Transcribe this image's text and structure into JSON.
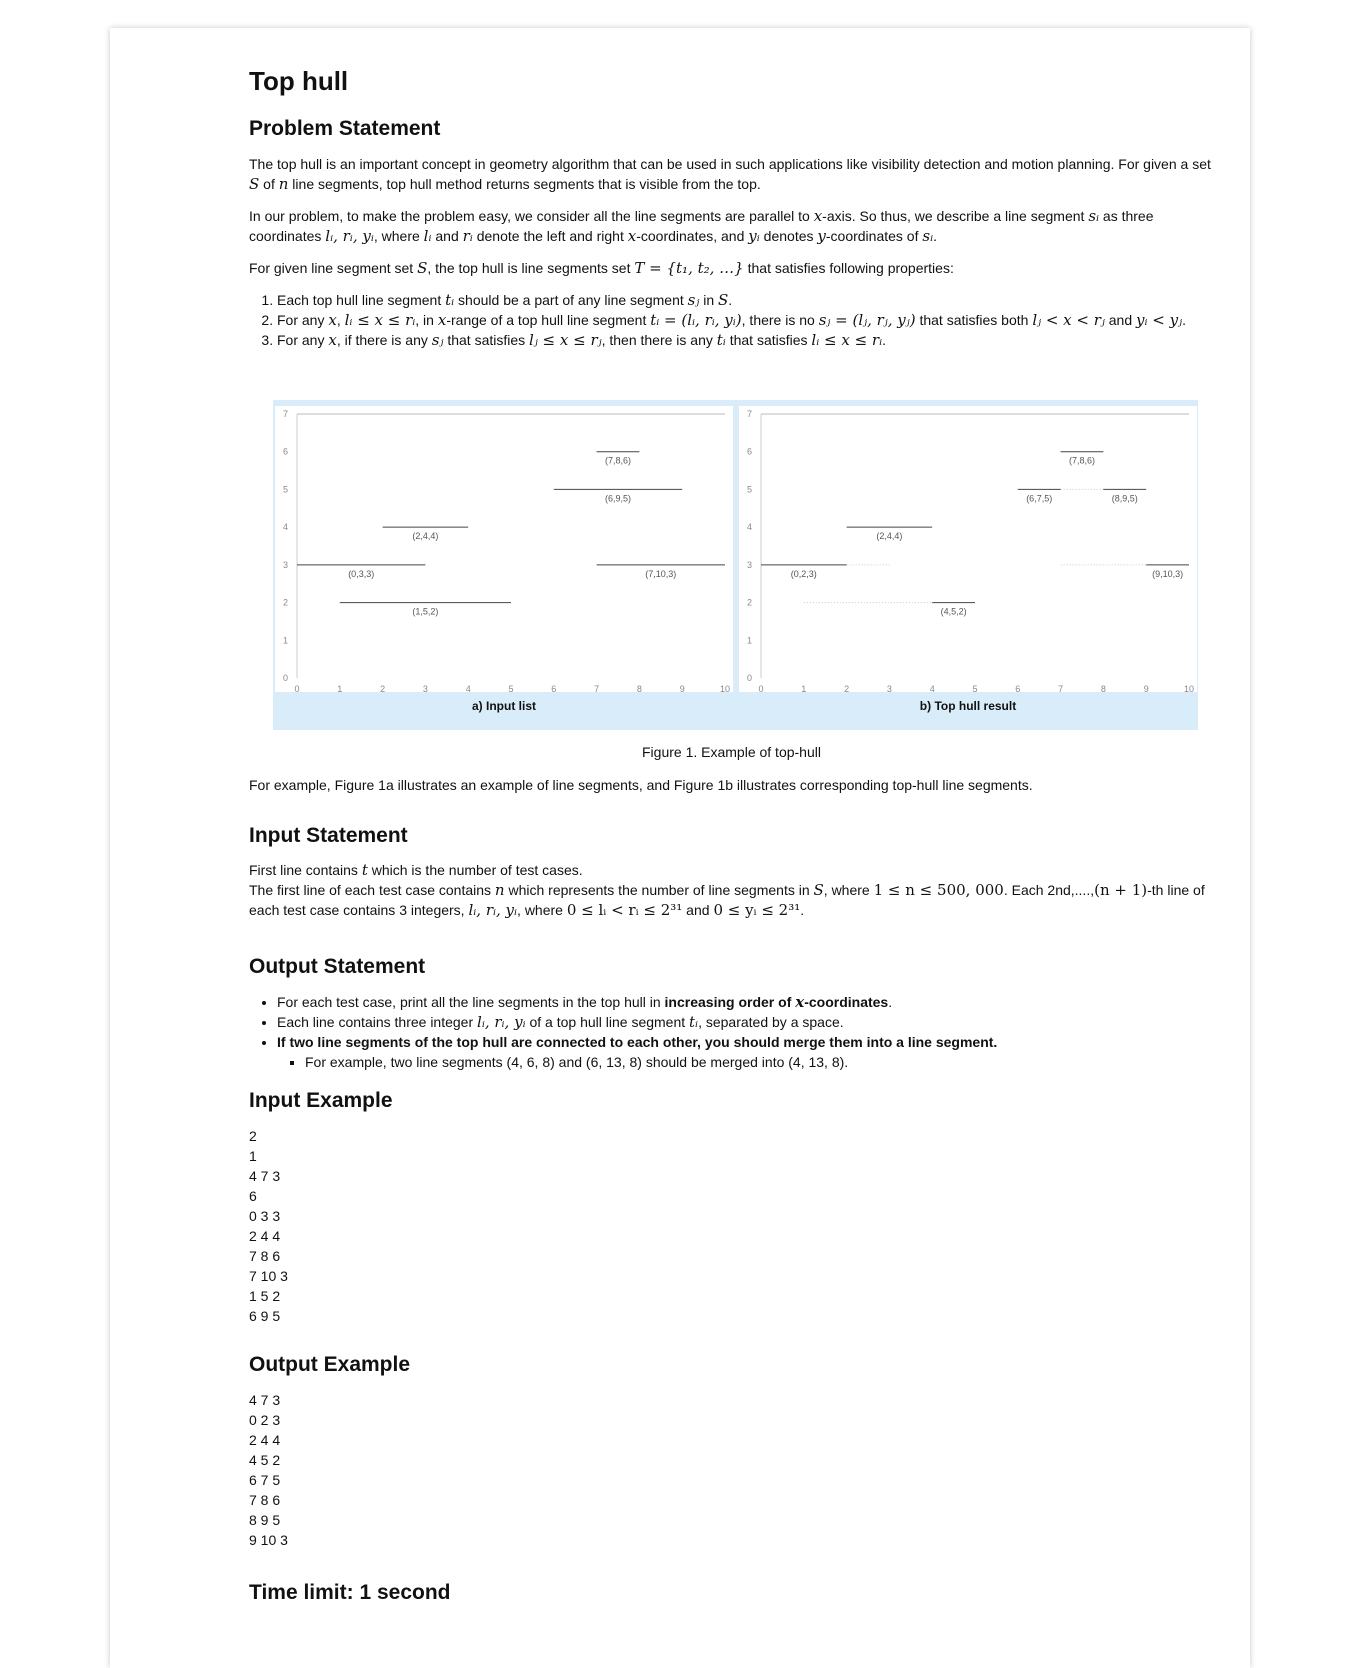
{
  "title": "Top hull",
  "problem": {
    "heading": "Problem Statement",
    "p1_a": "The top hull is an important concept in geometry algorithm that can be used in such applications like visibility detection and motion planning. For given a set ",
    "p1_b": " line segments, top hull method returns segments that is visible from the top.",
    "p2_a": "In our problem, to make the problem easy, we consider all the line segments are parallel to ",
    "p2_b": "-axis. So thus, we describe a line segment ",
    "p2_c": " as three coordinates ",
    "p2_d": ", where ",
    "p2_e": " and ",
    "p2_f": " denote the left and right ",
    "p2_g": "-coordinates, and ",
    "p2_h": " denotes ",
    "p2_i": "-coordinates of ",
    "p3_a": "For given line segment set ",
    "p3_b": ", the top hull is line segments set ",
    "p3_c": " that satisfies following properties:",
    "li1_a": "Each top hull line segment ",
    "li1_b": " should be a part of any line segment ",
    "li1_c": " in ",
    "li2_a": "For any ",
    "li2_b": ", in ",
    "li2_c": "-range of a top hull line segment ",
    "li2_d": ", there is no ",
    "li2_e": " that satisfies both ",
    "li2_f": " and",
    "li3_a": "For any ",
    "li3_b": ", if there is any ",
    "li3_c": " that satisfies ",
    "li3_d": ", then there is any ",
    "li3_e": " that satisfies ",
    "figure_caption": "Figure 1. Example of top-hull",
    "after_figure": "For example, Figure 1a illustrates an example of line segments, and Figure 1b illustrates corresponding top-hull line segments."
  },
  "math": {
    "S": "S",
    "of": " of ",
    "n": "n",
    "x": "x",
    "y": "y",
    "si": "s",
    "si_sub": "i",
    "lry": "lᵢ, rᵢ, yᵢ",
    "li": "lᵢ",
    "ri": "rᵢ",
    "yi": "yᵢ",
    "si_full": "sᵢ",
    "T_set": "T = {t₁, t₂, …}",
    "ti": "tᵢ",
    "sj": "sⱼ",
    "range": "lᵢ ≤ x ≤ rᵢ",
    "ti_def": "tᵢ = (lᵢ, rᵢ, yᵢ)",
    "sj_def": "sⱼ = (lⱼ, rⱼ, yⱼ)",
    "lj_cond": "lⱼ < x < rⱼ",
    "yi_cond": "yᵢ < yⱼ",
    "lj_range": "lⱼ ≤ x ≤ rⱼ",
    "li_range": "lᵢ ≤ x ≤ rᵢ",
    "t": "t",
    "n_range": "1 ≤ n ≤ 500, 000",
    "n1": "(n + 1)",
    "l_range": "0 ≤ lᵢ < rᵢ ≤ 2³¹",
    "y_range": "0 ≤ yᵢ ≤ 2³¹"
  },
  "input_statement": {
    "heading": "Input Statement",
    "l1_a": "First line contains ",
    "l1_b": " which is the number of test cases.",
    "l2_a": "The first line of each test case contains ",
    "l2_b": " which represents the number of line segments in ",
    "l2_c": ", where ",
    "l2_d": ". Each 2nd,....,",
    "l2_e": "-th line of each test case contains 3 integers, ",
    "l2_f": ", where ",
    "l2_g": " and ",
    "l2_h": "."
  },
  "output_statement": {
    "heading": "Output Statement",
    "b1_a": "For each test case, print all the line segments in the top hull in ",
    "b1_b": "increasing order of ",
    "b1_c": "-coordinates",
    "b1_d": ".",
    "b2_a": "Each line contains three integer ",
    "b2_b": " of a top hull line segment ",
    "b2_c": ", separated by a space.",
    "b3": "If two line segments of the top hull are connected to each other, you should merge them into a line segment.",
    "b3_sub": "For example, two line segments (4, 6, 8) and (6, 13, 8) should be merged into (4, 13, 8)."
  },
  "input_example": {
    "heading": "Input Example",
    "lines": [
      "2",
      "1",
      "4 7 3",
      "6",
      "0 3 3",
      "2 4 4",
      "7 8 6",
      "7 10 3",
      "1 5 2",
      "6 9 5"
    ]
  },
  "output_example": {
    "heading": "Output Example",
    "lines": [
      "4 7 3",
      "0 2 3",
      "2 4 4",
      "4 5 2",
      "6 7 5",
      "7 8 6",
      "8 9 5",
      "9 10 3"
    ]
  },
  "time_limit": "Time limit: 1 second",
  "chart_data": [
    {
      "type": "scatter",
      "title": "a) Input list",
      "xlim": [
        0,
        10
      ],
      "ylim": [
        0,
        7
      ],
      "xticks": [
        "0",
        "1",
        "2",
        "3",
        "4",
        "5",
        "6",
        "7",
        "8",
        "9",
        "10"
      ],
      "yticks": [
        "0",
        "1",
        "2",
        "3",
        "4",
        "5",
        "6",
        "7"
      ],
      "segments": [
        {
          "l": 0,
          "r": 3,
          "y": 3,
          "label": "(0,3,3)"
        },
        {
          "l": 2,
          "r": 4,
          "y": 4,
          "label": "(2,4,4)"
        },
        {
          "l": 7,
          "r": 8,
          "y": 6,
          "label": "(7,8,6)"
        },
        {
          "l": 7,
          "r": 10,
          "y": 3,
          "label": "(7,10,3)"
        },
        {
          "l": 1,
          "r": 5,
          "y": 2,
          "label": "(1,5,2)"
        },
        {
          "l": 6,
          "r": 9,
          "y": 5,
          "label": "(6,9,5)"
        }
      ]
    },
    {
      "type": "scatter",
      "title": "b) Top hull result",
      "xlim": [
        0,
        10
      ],
      "ylim": [
        0,
        7
      ],
      "xticks": [
        "0",
        "1",
        "2",
        "3",
        "4",
        "5",
        "6",
        "7",
        "8",
        "9",
        "10"
      ],
      "yticks": [
        "0",
        "1",
        "2",
        "3",
        "4",
        "5",
        "6",
        "7"
      ],
      "segments": [
        {
          "l": 0,
          "r": 2,
          "y": 3,
          "label": "(0,2,3)"
        },
        {
          "l": 2,
          "r": 4,
          "y": 4,
          "label": "(2,4,4)"
        },
        {
          "l": 4,
          "r": 5,
          "y": 2,
          "label": "(4,5,2)"
        },
        {
          "l": 6,
          "r": 7,
          "y": 5,
          "label": "(6,7,5)"
        },
        {
          "l": 7,
          "r": 8,
          "y": 6,
          "label": "(7,8,6)"
        },
        {
          "l": 8,
          "r": 9,
          "y": 5,
          "label": "(8,9,5)"
        },
        {
          "l": 9,
          "r": 10,
          "y": 3,
          "label": "(9,10,3)"
        }
      ],
      "hidden_segments": [
        {
          "l": 2,
          "r": 3,
          "y": 3
        },
        {
          "l": 1,
          "r": 4,
          "y": 2
        },
        {
          "l": 7,
          "r": 8,
          "y": 5
        },
        {
          "l": 7,
          "r": 9,
          "y": 3
        }
      ]
    }
  ]
}
